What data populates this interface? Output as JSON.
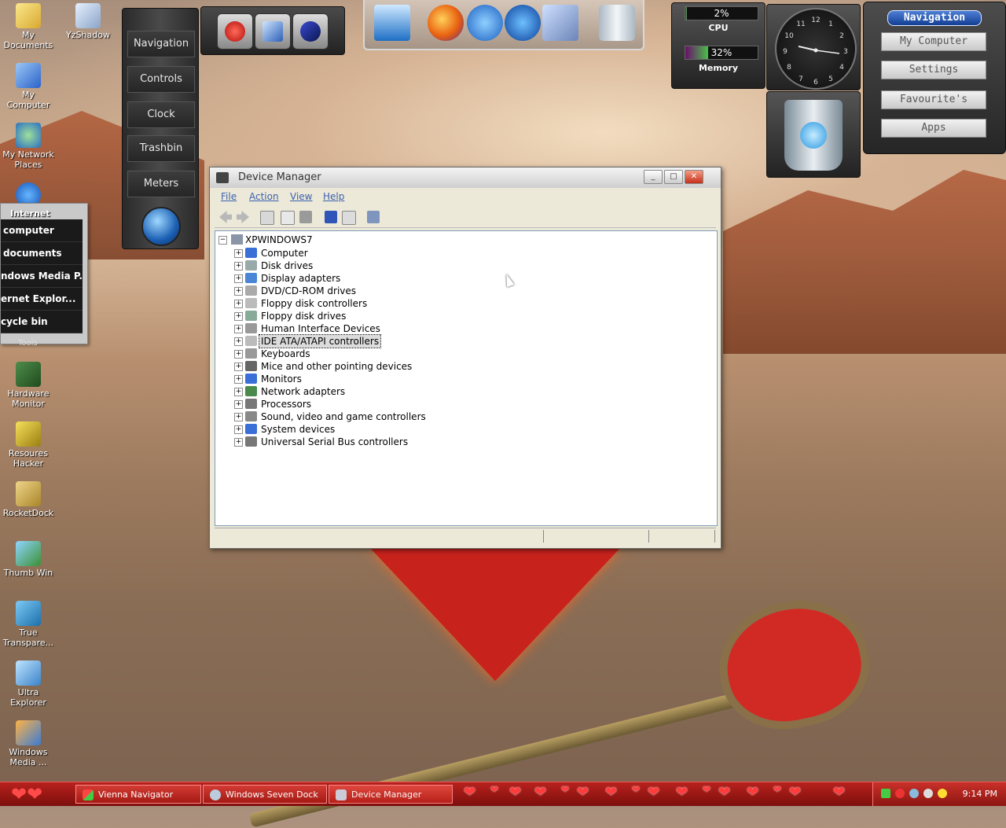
{
  "desktop": {
    "icons": [
      {
        "label": "My Documents",
        "name": "my-documents-icon"
      },
      {
        "label": "YzShadow",
        "name": "yzshadow-icon"
      },
      {
        "label": "My Computer",
        "name": "my-computer-icon"
      },
      {
        "label": "My Network Places",
        "name": "my-network-places-icon"
      },
      {
        "label": "Internet",
        "name": "internet-icon"
      },
      {
        "label": "Hardware Monitor",
        "name": "hardware-monitor-icon"
      },
      {
        "label": "Resoures Hacker",
        "name": "resource-hacker-icon"
      },
      {
        "label": "RocketDock",
        "name": "rocketdock-icon"
      },
      {
        "label": "Thumb Win",
        "name": "thumb-win-icon"
      },
      {
        "label": "True Transpare...",
        "name": "true-transparency-icon"
      },
      {
        "label": "Ultra Explorer",
        "name": "ultra-explorer-icon"
      },
      {
        "label": "Windows Media ...",
        "name": "windows-media-icon"
      }
    ]
  },
  "popup": {
    "title": "Internet",
    "items": [
      "computer",
      "documents",
      "ndows Media P...",
      "ernet Explor...",
      "cycle bin"
    ],
    "footer": "Tools"
  },
  "vienna_nav": {
    "buttons": [
      "Navigation",
      "Controls",
      "Clock",
      "Trashbin",
      "Meters"
    ]
  },
  "meters": {
    "cpu_value": "2%",
    "cpu_label": "CPU",
    "cpu_percent": 2,
    "mem_value": "32%",
    "mem_label": "Memory",
    "mem_percent": 32
  },
  "clock": {
    "numbers": [
      "12",
      "1",
      "2",
      "3",
      "4",
      "5",
      "6",
      "7",
      "8",
      "9",
      "10",
      "11"
    ]
  },
  "nav_panel": {
    "title": "Navigation",
    "buttons": [
      "My Computer",
      "Settings",
      "Favourite's",
      "Apps"
    ]
  },
  "device_manager": {
    "title": "Device Manager",
    "menu": [
      "File",
      "Action",
      "View",
      "Help"
    ],
    "root": "XPWINDOWS7",
    "nodes": [
      "Computer",
      "Disk drives",
      "Display adapters",
      "DVD/CD-ROM drives",
      "Floppy disk controllers",
      "Floppy disk drives",
      "Human Interface Devices",
      "IDE ATA/ATAPI controllers",
      "Keyboards",
      "Mice and other pointing devices",
      "Monitors",
      "Network adapters",
      "Processors",
      "Sound, video and game controllers",
      "System devices",
      "Universal Serial Bus controllers"
    ],
    "selected": "IDE ATA/ATAPI controllers"
  },
  "taskbar": {
    "tasks": [
      "Vienna Navigator",
      "Windows Seven Dock",
      "Device Manager"
    ],
    "time": "9:14 PM"
  },
  "colors": {
    "taskbar": "#b8211d",
    "menu_text": "#3a5fb0",
    "selection": "#dcdcdc"
  }
}
